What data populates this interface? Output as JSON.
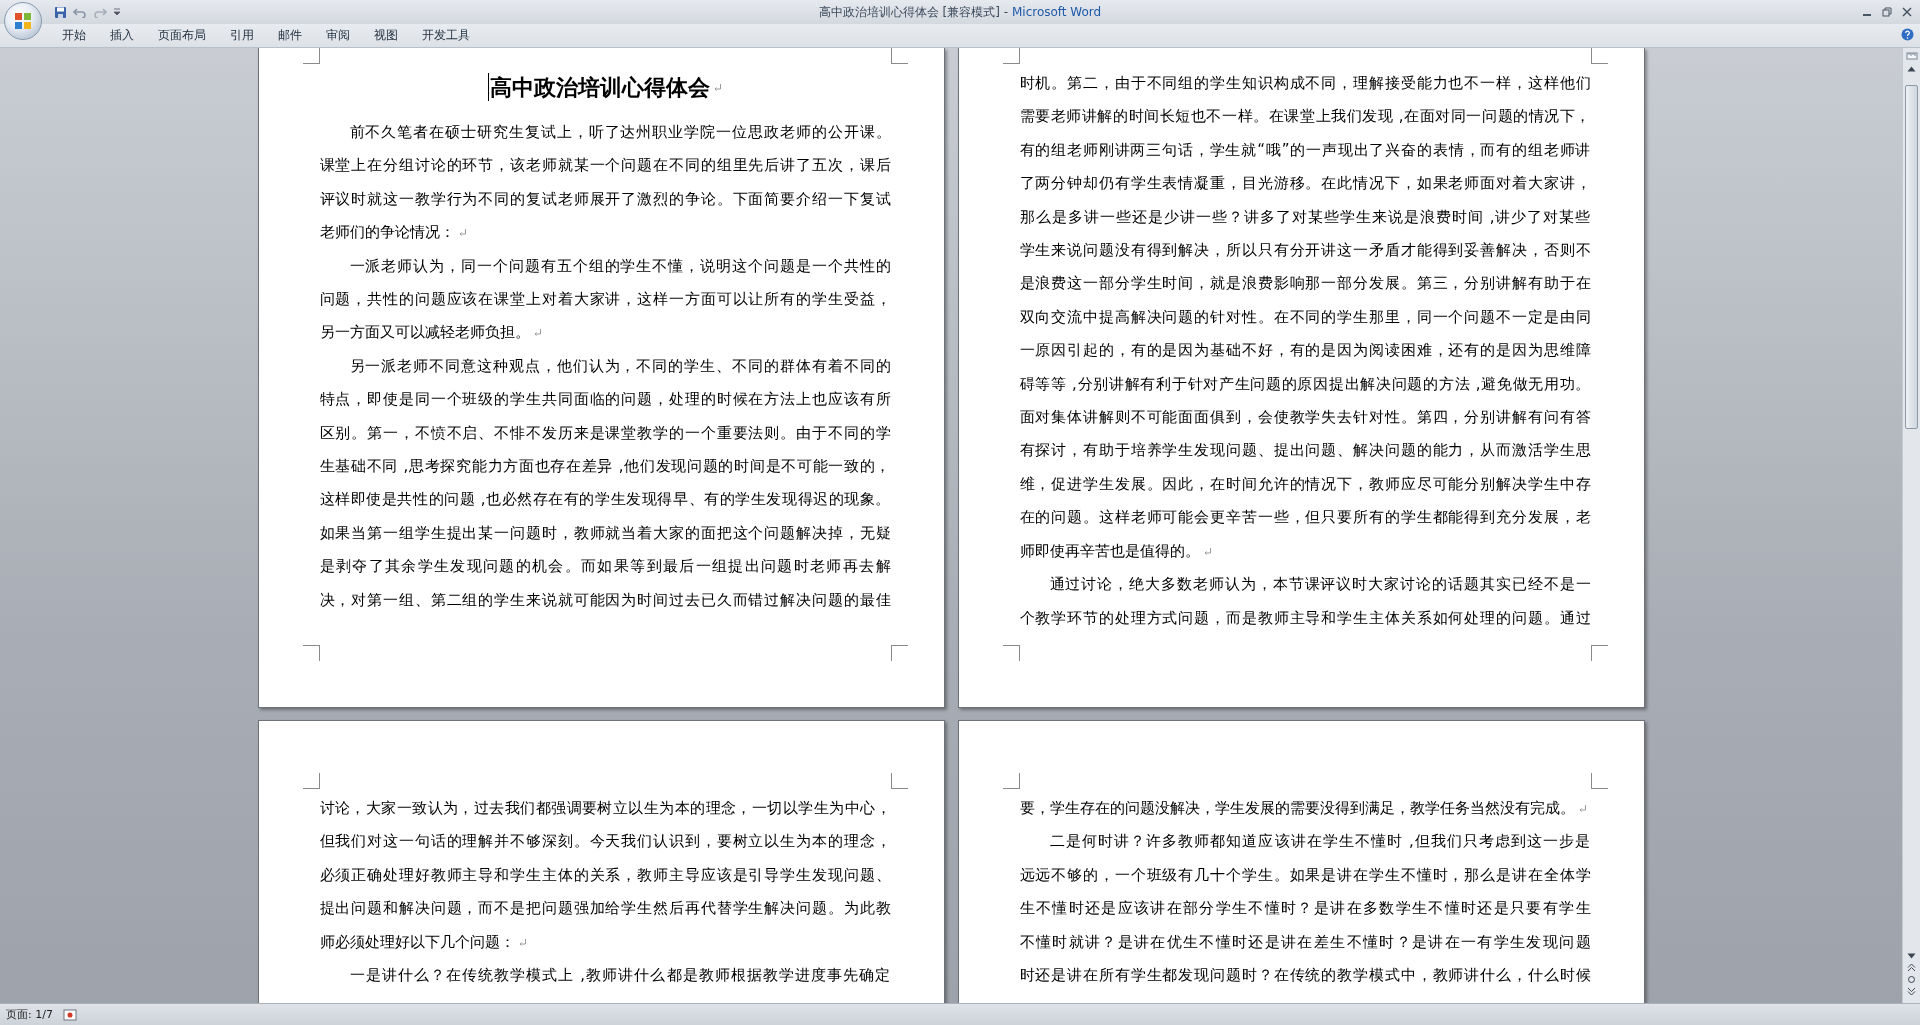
{
  "window": {
    "document": "高中政治培训心得体会 [兼容模式] -",
    "app": "Microsoft Word"
  },
  "ribbon_tabs": [
    {
      "label": "开始"
    },
    {
      "label": "插入"
    },
    {
      "label": "页面布局"
    },
    {
      "label": "引用"
    },
    {
      "label": "邮件"
    },
    {
      "label": "审阅"
    },
    {
      "label": "视图"
    },
    {
      "label": "开发工具"
    }
  ],
  "pages": [
    {
      "title": "高中政治培训心得体会",
      "paragraphs": [
        {
          "indent": true,
          "paragraph_mark": true,
          "lines": [
            "前不久笔者在硕士研究生复试上，听了达州职业学院一位思政老师的公开课。",
            "课堂上在分组讨论的环节，该老师就某一个问题在不同的组里先后讲了五次，课后",
            "评议时就这一教学行为不同的复试老师展开了激烈的争论。下面简要介绍一下复试",
            "老师们的争论情况："
          ]
        },
        {
          "indent": true,
          "paragraph_mark": true,
          "lines": [
            "一派老师认为，同一个问题有五个组的学生不懂，说明这个问题是一个共性的",
            "问题，共性的问题应该在课堂上对着大家讲，这样一方面可以让所有的学生受益，",
            "另一方面又可以减轻老师负担。"
          ]
        },
        {
          "indent": true,
          "paragraph_mark": false,
          "lines": [
            "另一派老师不同意这种观点，他们认为，不同的学生、不同的群体有着不同的",
            "特点，即使是同一个班级的学生共同面临的问题，处理的时候在方法上也应该有所",
            "区别。第一，不愤不启、不悱不发历来是课堂教学的一个重要法则。由于不同的学",
            "生基础不同 ,思考探究能力方面也存在差异 ,他们发现问题的时间是不可能一致的，",
            "这样即使是共性的问题 ,也必然存在有的学生发现得早、有的学生发现得迟的现象。",
            "如果当第一组学生提出某一问题时，教师就当着大家的面把这个问题解决掉，无疑",
            "是剥夺了其余学生发现问题的机会。而如果等到最后一组提出问题时老师再去解",
            "决，对第一组、第二组的学生来说就可能因为时间过去已久而错过解决问题的最佳"
          ]
        }
      ]
    },
    {
      "paragraphs": [
        {
          "indent": false,
          "paragraph_mark": true,
          "lines": [
            "时机。第二，由于不同组的学生知识构成不同，理解接受能力也不一样，这样他们",
            "需要老师讲解的时间长短也不一样。在课堂上我们发现 ,在面对同一问题的情况下，",
            "有的组老师刚讲两三句话，学生就“哦”的一声现出了兴奋的表情，而有的组老师讲",
            "了两分钟却仍有学生表情凝重，目光游移。在此情况下，如果老师面对着大家讲，",
            "那么是多讲一些还是少讲一些？讲多了对某些学生来说是浪费时间 ,讲少了对某些",
            "学生来说问题没有得到解决，所以只有分开讲这一矛盾才能得到妥善解决，否则不",
            "是浪费这一部分学生时间，就是浪费影响那一部分发展。第三，分别讲解有助于在",
            "双向交流中提高解决问题的针对性。在不同的学生那里，同一个问题不一定是由同",
            "一原因引起的，有的是因为基础不好，有的是因为阅读困难，还有的是因为思维障",
            "碍等等 ,分别讲解有利于针对产生问题的原因提出解决问题的方法 ,避免做无用功。",
            "面对集体讲解则不可能面面俱到，会使教学失去针对性。第四，分别讲解有问有答",
            "有探讨，有助于培养学生发现问题、提出问题、解决问题的能力，从而激活学生思",
            "维，促进学生发展。因此，在时间允许的情况下，教师应尽可能分别解决学生中存",
            "在的问题。这样老师可能会更辛苦一些，但只要所有的学生都能得到充分发展，老",
            "师即使再辛苦也是值得的。"
          ]
        },
        {
          "indent": true,
          "paragraph_mark": false,
          "lines": [
            "通过讨论，绝大多数老师认为，本节课评议时大家讨论的话题其实已经不是一",
            "个教学环节的处理方式问题，而是教师主导和学生主体关系如何处理的问题。通过"
          ]
        }
      ]
    },
    {
      "paragraphs": [
        {
          "indent": false,
          "paragraph_mark": true,
          "lines": [
            "讨论，大家一致认为，过去我们都强调要树立以生为本的理念，一切以学生为中心，",
            "但我们对这一句话的理解并不够深刻。今天我们认识到，要树立以生为本的理念，",
            "必须正确处理好教师主导和学生主体的关系，教师主导应该是引导学生发现问题、",
            "提出问题和解决问题，而不是把问题强加给学生然后再代替学生解决问题。为此教",
            "师必须处理好以下几个问题："
          ]
        },
        {
          "indent": true,
          "paragraph_mark": false,
          "lines": [
            "一是讲什么？在传统教学模式上 ,教师讲什么都是教师根据教学进度事先确定"
          ]
        }
      ]
    },
    {
      "paragraphs": [
        {
          "indent": false,
          "paragraph_mark": true,
          "lines": [
            "要，学生存在的问题没解决，学生发展的需要没得到满足，教学任务当然没有完成。"
          ]
        },
        {
          "indent": true,
          "paragraph_mark": false,
          "lines": [
            "二是何时讲？许多教师都知道应该讲在学生不懂时 ,但我们只考虑到这一步是",
            "远远不够的，一个班级有几十个学生。如果是讲在学生不懂时，那么是讲在全体学",
            "生不懂时还是应该讲在部分学生不懂时？是讲在多数学生不懂时还是只要有学生",
            "不懂时就讲？是讲在优生不懂时还是讲在差生不懂时？是讲在一有学生发现问题",
            "时还是讲在所有学生都发现问题时？在传统的教学模式中，教师讲什么，什么时候"
          ]
        }
      ]
    }
  ],
  "status_bar": {
    "page": "页面: 1/7"
  }
}
